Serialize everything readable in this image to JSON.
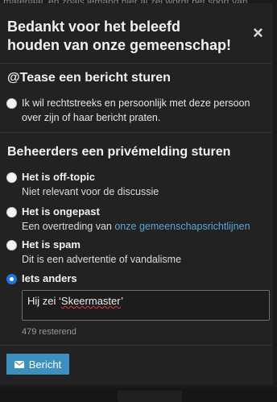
{
  "background_peek_text": "materiaal, en zoals iemand hier al zei wordt het soort van",
  "modal": {
    "title": "Bedankt voor het beleefd houden van onze gemeenschap!",
    "close_label": "×"
  },
  "user_section": {
    "title": "@Tease een bericht sturen",
    "option_text": "Ik wil rechtstreeks en persoonlijk met deze persoon over zijn of haar bericht praten."
  },
  "staff_section": {
    "title": "Beheerders een privémelding sturen",
    "options": [
      {
        "title": "Het is off-topic",
        "desc": "Niet relevant voor de discussie",
        "checked": false
      },
      {
        "title": "Het is ongepast",
        "desc_prefix": "Een overtreding van ",
        "desc_link": "onze gemeenschapsrichtlijnen",
        "checked": false
      },
      {
        "title": "Het is spam",
        "desc": "Dit is een advertentie of vandalisme",
        "checked": false
      },
      {
        "title": "Iets anders",
        "checked": true
      }
    ],
    "message_prefix": "Hij zei ‘",
    "message_word": "Skeermaster",
    "message_suffix": "’",
    "remaining": "479 resterend"
  },
  "submit": {
    "label": "Bericht",
    "icon": "envelope-icon",
    "color": "#3d8fbd"
  }
}
